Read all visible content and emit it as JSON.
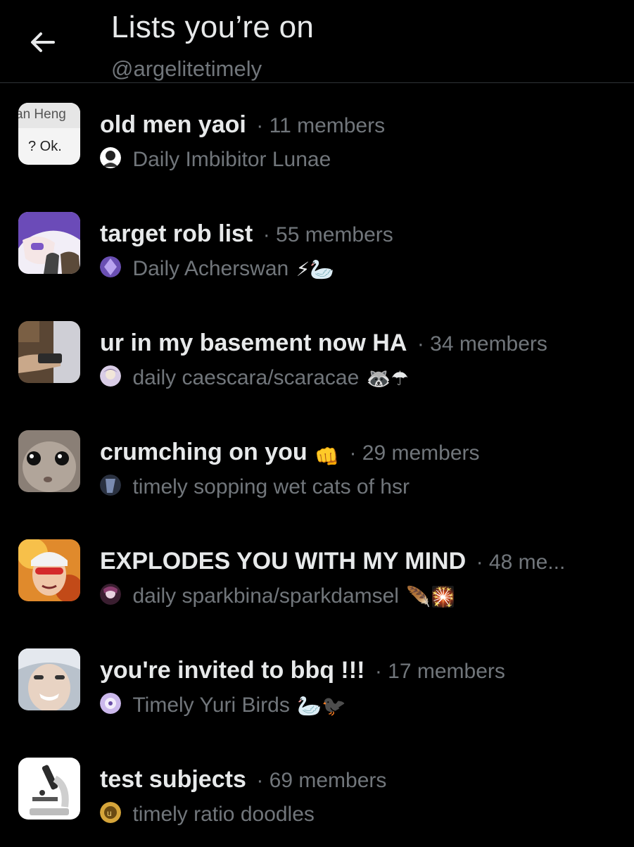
{
  "header": {
    "title": "Lists you’re on",
    "handle": "@argelitetimely"
  },
  "lists": [
    {
      "name": "old men yaoi",
      "members": "· 11 members",
      "owner": "Daily Imbibitor Lunae",
      "owner_emoji": "",
      "name_emoji": "",
      "thumb_text_1": "an Heng",
      "thumb_text_2": "? Ok.",
      "owner_color": "#ffffff"
    },
    {
      "name": "target rob list",
      "members": "· 55 members",
      "owner": "Daily Acherswan",
      "owner_emoji": "⚡🦢",
      "name_emoji": "",
      "owner_color": "#8a6fd6"
    },
    {
      "name": "ur in my basement now HA",
      "members": "· 34 members",
      "owner": "daily caescara/scaracae",
      "owner_emoji": "🦝☂",
      "name_emoji": "",
      "owner_color": "#b9a9c8"
    },
    {
      "name": "crumching on you",
      "members": "· 29 members",
      "owner": "timely sopping wet cats of hsr",
      "owner_emoji": "",
      "name_emoji": "👊",
      "owner_color": "#5a6a88"
    },
    {
      "name": "EXPLODES YOU WITH MY MIND",
      "members": "· 48 me...",
      "owner": "daily sparkbina/sparkdamsel",
      "owner_emoji": "🪶🎇",
      "name_emoji": "",
      "owner_color": "#9b5a8a"
    },
    {
      "name": "you're invited to bbq !!!",
      "members": "· 17 members",
      "owner": "Timely Yuri Birds",
      "owner_emoji": "🦢🐦‍⬛",
      "name_emoji": "",
      "owner_color": "#b6a3d8"
    },
    {
      "name": "test subjects",
      "members": "· 69 members",
      "owner": "timely ratio doodles",
      "owner_emoji": "",
      "name_emoji": "",
      "owner_color": "#d6a53a"
    }
  ],
  "colors": {
    "background": "#000000",
    "primary_text": "#e7e9ea",
    "secondary_text": "#71767b",
    "divider": "#2f3336"
  }
}
